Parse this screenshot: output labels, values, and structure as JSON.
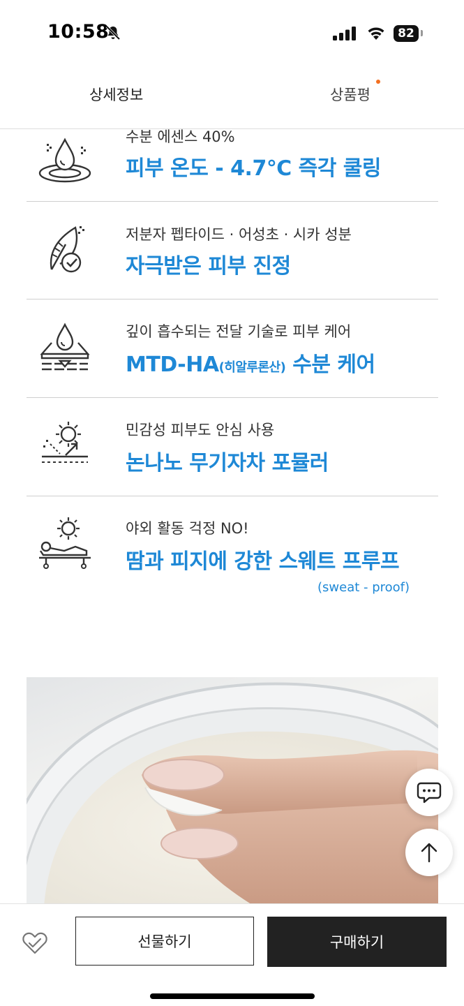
{
  "status": {
    "time": "10:58",
    "battery": "82"
  },
  "tabs": [
    {
      "label": "상세정보"
    },
    {
      "label": "상품평"
    }
  ],
  "features": [
    {
      "icon": "water-drop-ripple-icon",
      "sub": "수분 에센스 40%",
      "title": "피부 온도 - 4.7℃ 즉각 쿨링"
    },
    {
      "icon": "feather-check-icon",
      "sub": "저분자 펩타이드 · 어성초 · 시카 성분",
      "title": "자극받은 피부 진정"
    },
    {
      "icon": "drop-layers-icon",
      "sub": "깊이 흡수되는 전달 기술로 피부 케어",
      "title_main": "MTD-HA",
      "title_small": "(히알루론산)",
      "title_tail": " 수분 케어"
    },
    {
      "icon": "sun-shield-icon",
      "sub": "민감성 피부도 안심 사용",
      "title": "논나노 무기자차 포뮬러"
    },
    {
      "icon": "sun-lounger-icon",
      "sub": "야외 활동 걱정 NO!",
      "title": "땀과 피지에 강한 스웨트 프루프",
      "note": "(sweat - proof)"
    }
  ],
  "actions": {
    "gift": "선물하기",
    "buy": "구매하기"
  },
  "colors": {
    "accent": "#1e88d6",
    "dark_button": "#222222",
    "notification_dot": "#f37021"
  }
}
